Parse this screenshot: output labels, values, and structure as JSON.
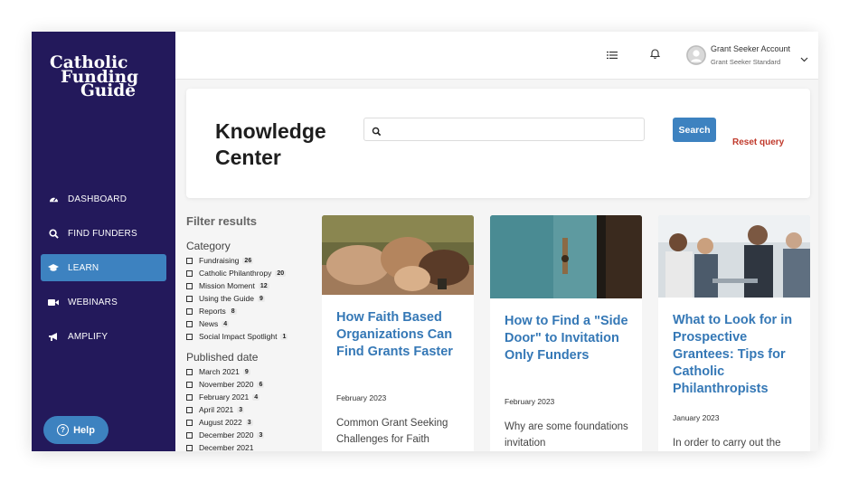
{
  "brand": {
    "line1": "Catholic",
    "line2": "Funding",
    "line3": "Guide"
  },
  "nav": [
    {
      "label": "DASHBOARD",
      "icon": "dashboard-icon"
    },
    {
      "label": "FIND FUNDERS",
      "icon": "search-icon"
    },
    {
      "label": "LEARN",
      "icon": "graduation-cap-icon",
      "active": true
    },
    {
      "label": "WEBINARS",
      "icon": "video-camera-icon"
    },
    {
      "label": "AMPLIFY",
      "icon": "megaphone-icon"
    }
  ],
  "help": {
    "label": "Help"
  },
  "account": {
    "name": "Grant Seeker Account",
    "type": "Grant Seeker Standard"
  },
  "page": {
    "title": "Knowledge Center"
  },
  "search": {
    "placeholder": "",
    "value": "",
    "button_label": "Search",
    "reset_label": "Reset query"
  },
  "filters": {
    "title": "Filter results",
    "category_label": "Category",
    "categories": [
      {
        "label": "Fundraising",
        "count": "26"
      },
      {
        "label": "Catholic Philanthropy",
        "count": "20"
      },
      {
        "label": "Mission Moment",
        "count": "12"
      },
      {
        "label": "Using the Guide",
        "count": "9"
      },
      {
        "label": "Reports",
        "count": "8"
      },
      {
        "label": "News",
        "count": "4"
      },
      {
        "label": "Social Impact Spotlight",
        "count": "1"
      }
    ],
    "date_label": "Published date",
    "dates": [
      {
        "label": "March 2021",
        "count": "9"
      },
      {
        "label": "November 2020",
        "count": "6"
      },
      {
        "label": "February 2021",
        "count": "4"
      },
      {
        "label": "April 2021",
        "count": "3"
      },
      {
        "label": "August 2022",
        "count": "3"
      },
      {
        "label": "December 2020",
        "count": "3"
      },
      {
        "label": "December 2021",
        "count": ""
      }
    ]
  },
  "articles": [
    {
      "title": "How Faith Based Organizations Can Find Grants Faster",
      "date": "February 2023",
      "excerpt": "Common Grant Seeking Challenges for Faith"
    },
    {
      "title": "How to Find a \"Side Door\" to Invitation Only Funders",
      "date": "February 2023",
      "excerpt": "Why are some foundations invitation"
    },
    {
      "title": "What to Look for in Prospective Grantees: Tips for Catholic Philanthropists",
      "date": "January 2023",
      "excerpt": "In order to carry out the"
    }
  ],
  "colors": {
    "sidebar": "#23195b",
    "accent": "#3d82c0",
    "link": "#3578b6",
    "reset": "#c0392b"
  }
}
